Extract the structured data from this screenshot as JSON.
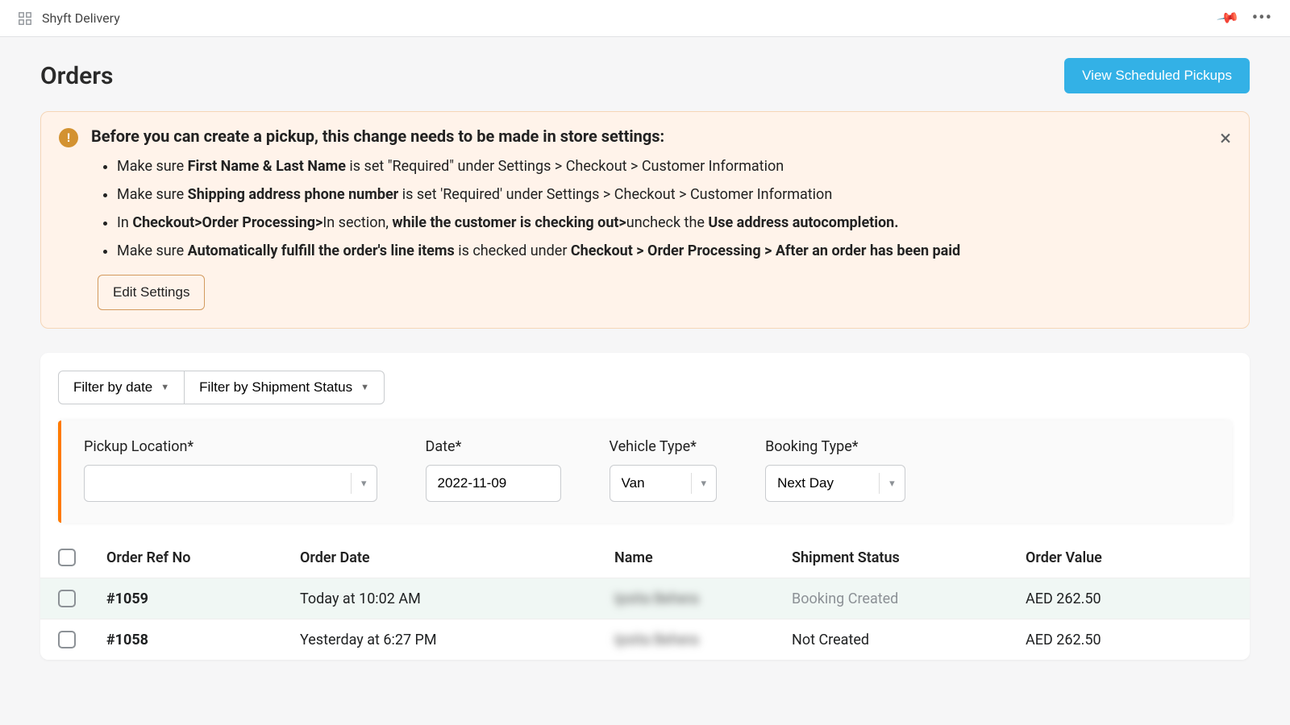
{
  "topbar": {
    "title": "Shyft Delivery"
  },
  "header": {
    "title": "Orders",
    "primary_button": "View Scheduled Pickups"
  },
  "alert": {
    "title": "Before you can create a pickup, this change needs to be made in store settings:",
    "items": [
      {
        "pre": "Make sure ",
        "b1": "First Name & Last Name",
        "mid": " is set \"Required\" under Settings > Checkout > Customer Information"
      },
      {
        "pre": "Make sure ",
        "b1": "Shipping address phone number",
        "mid": " is set 'Required' under Settings > Checkout > Customer Information"
      },
      {
        "pre": "In ",
        "b1": "Checkout>Order Processing>",
        "mid": "In section, ",
        "b2": "while the customer is checking out>",
        "mid2": "uncheck the ",
        "b3": "Use address autocompletion."
      },
      {
        "pre": "Make sure ",
        "b1": "Automatically fulfill the order's line items",
        "mid": " is checked under ",
        "b2": "Checkout > Order Processing > After an order has been paid"
      }
    ],
    "action": "Edit Settings"
  },
  "filters": {
    "date": "Filter by date",
    "status": "Filter by Shipment Status"
  },
  "form": {
    "pickup_label": "Pickup Location*",
    "pickup_value": "",
    "date_label": "Date*",
    "date_value": "2022-11-09",
    "vehicle_label": "Vehicle Type*",
    "vehicle_value": "Van",
    "booking_label": "Booking Type*",
    "booking_value": "Next Day"
  },
  "table": {
    "headers": {
      "ref": "Order Ref No",
      "date": "Order Date",
      "name": "Name",
      "status": "Shipment Status",
      "value": "Order Value"
    },
    "rows": [
      {
        "ref": "#1059",
        "date": "Today at 10:02 AM",
        "name": "Ipsita Behera",
        "status": "Booking Created",
        "status_muted": true,
        "value": "AED 262.50",
        "highlight": true
      },
      {
        "ref": "#1058",
        "date": "Yesterday at 6:27 PM",
        "name": "Ipsita Behera",
        "status": "Not Created",
        "status_muted": false,
        "value": "AED 262.50",
        "highlight": false
      }
    ]
  }
}
